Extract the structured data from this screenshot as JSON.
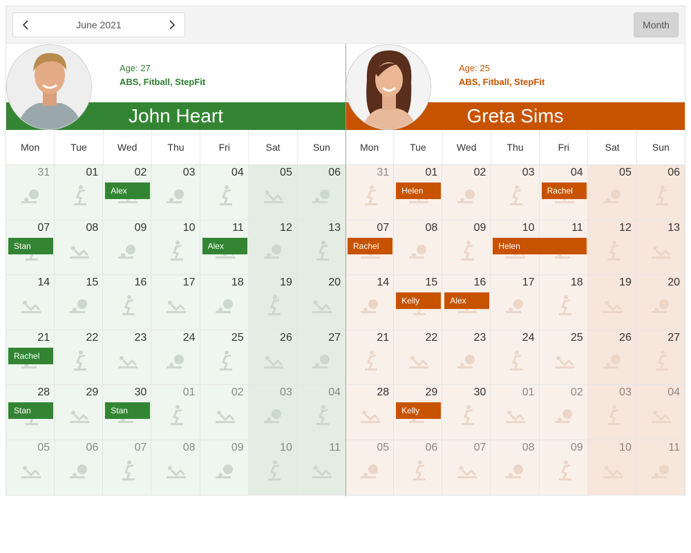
{
  "toolbar": {
    "date_label": "June 2021",
    "prev_icon": "chevron-left-icon",
    "next_icon": "chevron-right-icon",
    "view_button": "Month"
  },
  "weekdays": [
    "Mon",
    "Tue",
    "Wed",
    "Thu",
    "Fri",
    "Sat",
    "Sun"
  ],
  "weeks": [
    [
      "31",
      "01",
      "02",
      "03",
      "04",
      "05",
      "06"
    ],
    [
      "07",
      "08",
      "09",
      "10",
      "11",
      "12",
      "13"
    ],
    [
      "14",
      "15",
      "16",
      "17",
      "18",
      "19",
      "20"
    ],
    [
      "21",
      "22",
      "23",
      "24",
      "25",
      "26",
      "27"
    ],
    [
      "28",
      "29",
      "30",
      "01",
      "02",
      "03",
      "04"
    ],
    [
      "05",
      "06",
      "07",
      "08",
      "09",
      "10",
      "11"
    ]
  ],
  "resources": [
    {
      "name": "John Heart",
      "age_label": "Age: 27",
      "skills": "ABS, Fitball, StepFit",
      "avatar_icon": "male-avatar-icon",
      "color": "#338533",
      "text_color": "#2e7d32",
      "cell_color": "#eff5ef",
      "weekend_color": "#e3ede3",
      "icon_color": "#cbd8cb",
      "events": [
        {
          "text": "Alex",
          "week": 0,
          "day": 2,
          "span": 1
        },
        {
          "text": "Stan",
          "week": 1,
          "day": 0,
          "span": 1
        },
        {
          "text": "Alex",
          "week": 1,
          "day": 4,
          "span": 1
        },
        {
          "text": "Rachel",
          "week": 3,
          "day": 0,
          "span": 1
        },
        {
          "text": "Stan",
          "week": 4,
          "day": 0,
          "span": 1
        },
        {
          "text": "Stan",
          "week": 4,
          "day": 2,
          "span": 1
        }
      ]
    },
    {
      "name": "Greta Sims",
      "age_label": "Age: 25",
      "skills": "ABS, Fitball, StepFit",
      "avatar_icon": "female-avatar-icon",
      "color": "#c75300",
      "text_color": "#c75300",
      "cell_color": "#faf0ea",
      "weekend_color": "#f7e6dc",
      "icon_color": "#ecd6c8",
      "events": [
        {
          "text": "Helen",
          "week": 0,
          "day": 1,
          "span": 1
        },
        {
          "text": "Rachel",
          "week": 0,
          "day": 4,
          "span": 1
        },
        {
          "text": "Rachel",
          "week": 1,
          "day": 0,
          "span": 1
        },
        {
          "text": "Helen",
          "week": 1,
          "day": 3,
          "span": 2
        },
        {
          "text": "Kelly",
          "week": 2,
          "day": 1,
          "span": 1
        },
        {
          "text": "Alex",
          "week": 2,
          "day": 2,
          "span": 1
        },
        {
          "text": "Kelly",
          "week": 4,
          "day": 1,
          "span": 1
        }
      ]
    }
  ],
  "cell_icons": [
    "fitball-icon",
    "stepfit-icon",
    "abs-icon"
  ]
}
